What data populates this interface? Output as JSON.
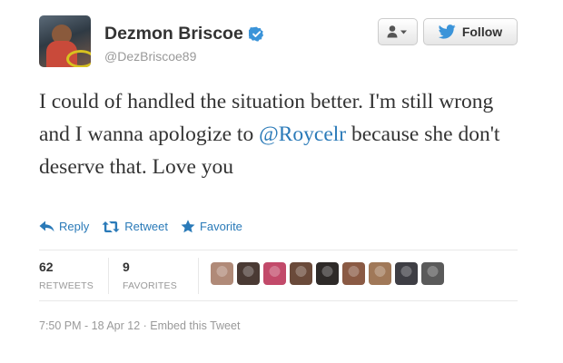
{
  "profile": {
    "name": "Dezmon Briscoe",
    "handle": "@DezBriscoe89",
    "verified": true
  },
  "buttons": {
    "user_actions_icon": "user-dropdown-icon",
    "follow_label": "Follow",
    "follow_icon": "twitter-bird-icon"
  },
  "tweet": {
    "text_before": "I could of handled the situation better. I'm still wrong and I wanna apologize to ",
    "mention": "@Roycelr",
    "text_after": " because she don't deserve that. Love you"
  },
  "actions": {
    "reply": "Reply",
    "retweet": "Retweet",
    "favorite": "Favorite"
  },
  "stats": {
    "retweets_count": "62",
    "retweets_label": "RETWEETS",
    "favorites_count": "9",
    "favorites_label": "FAVORITES"
  },
  "favoriters": [
    {
      "color": "#b08a78"
    },
    {
      "color": "#4a3a34"
    },
    {
      "color": "#c24a6a"
    },
    {
      "color": "#6a4a3a"
    },
    {
      "color": "#2e2a28"
    },
    {
      "color": "#8a5a44"
    },
    {
      "color": "#a07858"
    },
    {
      "color": "#3e3e44"
    },
    {
      "color": "#5a5a5a"
    }
  ],
  "meta": {
    "time": "7:50 PM - 18 Apr 12",
    "separator": " · ",
    "embed": "Embed this Tweet"
  },
  "colors": {
    "link": "#2a7ab8",
    "verified": "#3b94d9",
    "muted": "#999999"
  }
}
